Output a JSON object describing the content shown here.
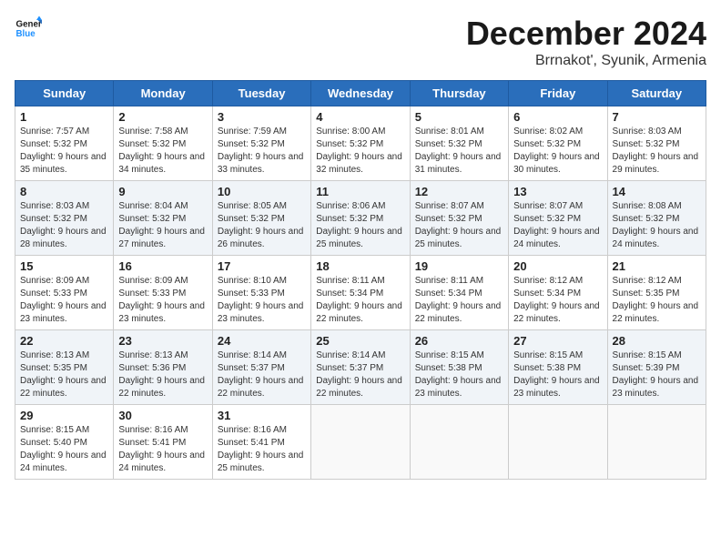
{
  "logo": {
    "line1": "General",
    "line2": "Blue"
  },
  "title": "December 2024",
  "location": "Brrnakot', Syunik, Armenia",
  "headers": [
    "Sunday",
    "Monday",
    "Tuesday",
    "Wednesday",
    "Thursday",
    "Friday",
    "Saturday"
  ],
  "weeks": [
    [
      {
        "day": "1",
        "sunrise": "7:57 AM",
        "sunset": "5:32 PM",
        "daylight": "9 hours and 35 minutes."
      },
      {
        "day": "2",
        "sunrise": "7:58 AM",
        "sunset": "5:32 PM",
        "daylight": "9 hours and 34 minutes."
      },
      {
        "day": "3",
        "sunrise": "7:59 AM",
        "sunset": "5:32 PM",
        "daylight": "9 hours and 33 minutes."
      },
      {
        "day": "4",
        "sunrise": "8:00 AM",
        "sunset": "5:32 PM",
        "daylight": "9 hours and 32 minutes."
      },
      {
        "day": "5",
        "sunrise": "8:01 AM",
        "sunset": "5:32 PM",
        "daylight": "9 hours and 31 minutes."
      },
      {
        "day": "6",
        "sunrise": "8:02 AM",
        "sunset": "5:32 PM",
        "daylight": "9 hours and 30 minutes."
      },
      {
        "day": "7",
        "sunrise": "8:03 AM",
        "sunset": "5:32 PM",
        "daylight": "9 hours and 29 minutes."
      }
    ],
    [
      {
        "day": "8",
        "sunrise": "8:03 AM",
        "sunset": "5:32 PM",
        "daylight": "9 hours and 28 minutes."
      },
      {
        "day": "9",
        "sunrise": "8:04 AM",
        "sunset": "5:32 PM",
        "daylight": "9 hours and 27 minutes."
      },
      {
        "day": "10",
        "sunrise": "8:05 AM",
        "sunset": "5:32 PM",
        "daylight": "9 hours and 26 minutes."
      },
      {
        "day": "11",
        "sunrise": "8:06 AM",
        "sunset": "5:32 PM",
        "daylight": "9 hours and 25 minutes."
      },
      {
        "day": "12",
        "sunrise": "8:07 AM",
        "sunset": "5:32 PM",
        "daylight": "9 hours and 25 minutes."
      },
      {
        "day": "13",
        "sunrise": "8:07 AM",
        "sunset": "5:32 PM",
        "daylight": "9 hours and 24 minutes."
      },
      {
        "day": "14",
        "sunrise": "8:08 AM",
        "sunset": "5:32 PM",
        "daylight": "9 hours and 24 minutes."
      }
    ],
    [
      {
        "day": "15",
        "sunrise": "8:09 AM",
        "sunset": "5:33 PM",
        "daylight": "9 hours and 23 minutes."
      },
      {
        "day": "16",
        "sunrise": "8:09 AM",
        "sunset": "5:33 PM",
        "daylight": "9 hours and 23 minutes."
      },
      {
        "day": "17",
        "sunrise": "8:10 AM",
        "sunset": "5:33 PM",
        "daylight": "9 hours and 23 minutes."
      },
      {
        "day": "18",
        "sunrise": "8:11 AM",
        "sunset": "5:34 PM",
        "daylight": "9 hours and 22 minutes."
      },
      {
        "day": "19",
        "sunrise": "8:11 AM",
        "sunset": "5:34 PM",
        "daylight": "9 hours and 22 minutes."
      },
      {
        "day": "20",
        "sunrise": "8:12 AM",
        "sunset": "5:34 PM",
        "daylight": "9 hours and 22 minutes."
      },
      {
        "day": "21",
        "sunrise": "8:12 AM",
        "sunset": "5:35 PM",
        "daylight": "9 hours and 22 minutes."
      }
    ],
    [
      {
        "day": "22",
        "sunrise": "8:13 AM",
        "sunset": "5:35 PM",
        "daylight": "9 hours and 22 minutes."
      },
      {
        "day": "23",
        "sunrise": "8:13 AM",
        "sunset": "5:36 PM",
        "daylight": "9 hours and 22 minutes."
      },
      {
        "day": "24",
        "sunrise": "8:14 AM",
        "sunset": "5:37 PM",
        "daylight": "9 hours and 22 minutes."
      },
      {
        "day": "25",
        "sunrise": "8:14 AM",
        "sunset": "5:37 PM",
        "daylight": "9 hours and 22 minutes."
      },
      {
        "day": "26",
        "sunrise": "8:15 AM",
        "sunset": "5:38 PM",
        "daylight": "9 hours and 23 minutes."
      },
      {
        "day": "27",
        "sunrise": "8:15 AM",
        "sunset": "5:38 PM",
        "daylight": "9 hours and 23 minutes."
      },
      {
        "day": "28",
        "sunrise": "8:15 AM",
        "sunset": "5:39 PM",
        "daylight": "9 hours and 23 minutes."
      }
    ],
    [
      {
        "day": "29",
        "sunrise": "8:15 AM",
        "sunset": "5:40 PM",
        "daylight": "9 hours and 24 minutes."
      },
      {
        "day": "30",
        "sunrise": "8:16 AM",
        "sunset": "5:41 PM",
        "daylight": "9 hours and 24 minutes."
      },
      {
        "day": "31",
        "sunrise": "8:16 AM",
        "sunset": "5:41 PM",
        "daylight": "9 hours and 25 minutes."
      },
      null,
      null,
      null,
      null
    ]
  ],
  "labels": {
    "sunrise": "Sunrise:",
    "sunset": "Sunset:",
    "daylight": "Daylight:"
  }
}
